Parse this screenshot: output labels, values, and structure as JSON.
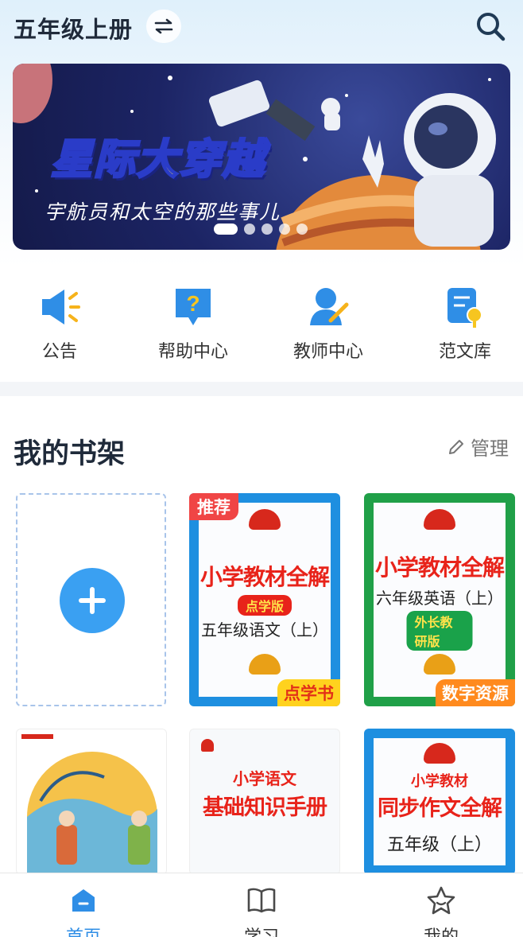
{
  "header": {
    "grade": "五年级上册",
    "switch_icon": "swap-icon",
    "search_icon": "search-icon"
  },
  "banner": {
    "title": "星际大穿越",
    "subtitle": "宇航员和太空的那些事儿",
    "slide_count": 5,
    "active_slide": 1
  },
  "quick_menu": [
    {
      "label": "公告",
      "icon": "megaphone-icon"
    },
    {
      "label": "帮助中心",
      "icon": "help-icon"
    },
    {
      "label": "教师中心",
      "icon": "teacher-icon"
    },
    {
      "label": "范文库",
      "icon": "essay-library-icon"
    }
  ],
  "shelf": {
    "title": "我的书架",
    "manage_label": "管理",
    "books": [
      {
        "badge_top": "推荐",
        "title": "小学教材全解",
        "edition": "点学版",
        "subtitle": "五年级语文（上）",
        "badge_bottom": "点学书"
      },
      {
        "title": "小学教材全解",
        "subtitle": "六年级英语（上）",
        "edition": "外长教研版",
        "badge_bottom": "数字资源"
      },
      {
        "title": "",
        "subtitle": ""
      },
      {
        "series": "小学语文",
        "title": "基础知识手册"
      },
      {
        "series": "小学教材",
        "title": "同步作文全解",
        "subtitle": "五年级（上）"
      }
    ]
  },
  "bottom_nav": [
    {
      "label": "首页",
      "icon": "home-icon",
      "active": true
    },
    {
      "label": "学习",
      "icon": "book-icon",
      "active": false
    },
    {
      "label": "我的",
      "icon": "star-icon",
      "active": false
    }
  ],
  "colors": {
    "accent": "#2f8ee6",
    "badge_red": "#f04545"
  }
}
